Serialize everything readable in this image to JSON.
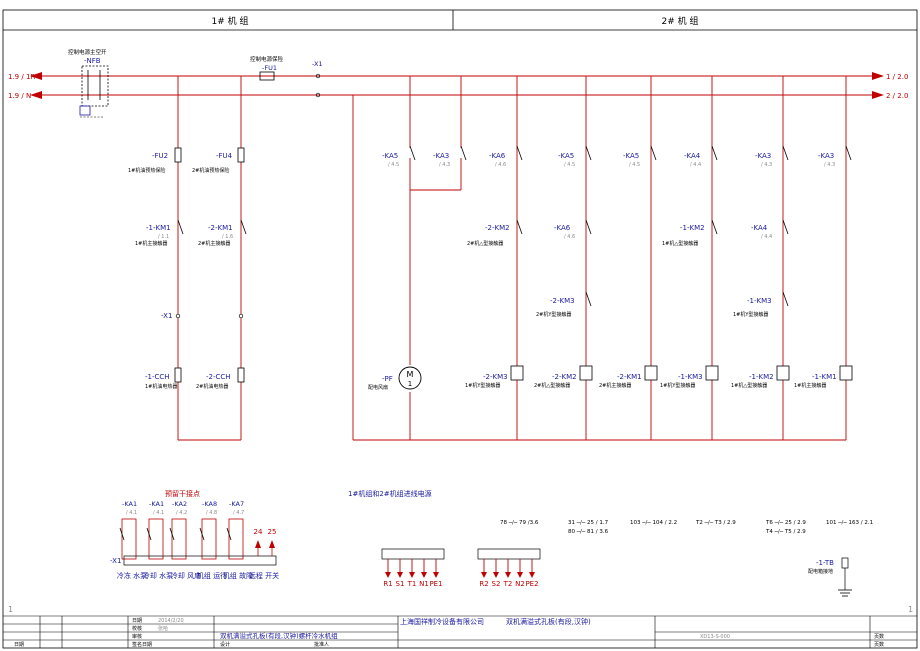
{
  "header": {
    "unit1": "1#  机  组",
    "unit2": "2#  机  组"
  },
  "power": {
    "phase_left": "1.9 / 1R",
    "neutral_left": "1.9 / N",
    "phase_right": "1 / 2.0",
    "neutral_right": "2 / 2.0",
    "breaker_caption": "控制电源主空开",
    "breaker_tag": "-NFB",
    "fuse_caption": "控制电源保险",
    "fuse_tag": "-FU1",
    "terminal_tag": "-X1"
  },
  "left_branches": [
    {
      "fuse": "-FU2",
      "fuse_note": "1#机油预热保险",
      "km": "-1-KM1",
      "km_ref": "/ 1.1",
      "km_note": "1#机主接触器",
      "x": "-X1",
      "ccr": "-1-CCH",
      "ccr_note": "1#机油电热器"
    },
    {
      "fuse": "-FU4",
      "fuse_note": "2#机油预热保险",
      "km": "-2-KM1",
      "km_ref": "/ 1.6",
      "km_note": "2#机主接触器",
      "ccr": "-2-CCH",
      "ccr_note": "2#机油电热器"
    }
  ],
  "fan": {
    "tag": "-PF",
    "caption": "配电风扇",
    "symbol": "M",
    "number": "1"
  },
  "columns": [
    {
      "top": "-KA5",
      "top_ref": "/ 4.5"
    },
    {
      "top": "-KA3",
      "top_ref": "/ 4.3"
    },
    {
      "top": "-KA6",
      "top_ref": "/ 4.6",
      "mid": "-2-KM2",
      "mid_note": "2#机△型接触器",
      "coil": "-2-KM3",
      "coil_note": "1#机Y型接触器"
    },
    {
      "top": "-KA5",
      "top_ref": "/ 4.5",
      "mid": "-KA6",
      "mid_ref": "/ 4.6",
      "low": "-2-KM3",
      "low_note": "2#机Y型接触器",
      "coil": "-2-KM2",
      "coil_note": "2#机△型接触器"
    },
    {
      "top": "-KA5",
      "top_ref": "/ 4.5",
      "coil": "-2-KM1",
      "coil_note": "2#机主接触器"
    },
    {
      "top": "-KA4",
      "top_ref": "/ 4.4",
      "mid": "-1-KM2",
      "mid_note": "1#机△型接触器",
      "coil": "-1-KM3",
      "coil_note": "1#机Y型接触器"
    },
    {
      "top": "-KA3",
      "top_ref": "/ 4.3",
      "mid": "-KA4",
      "mid_ref": "/ 4.4",
      "low": "-1-KM3",
      "low_note": "1#机Y型接触器",
      "coil": "-1-KM2",
      "coil_note": "1#机△型接触器"
    },
    {
      "top": "-KA3",
      "top_ref": "/ 4.3",
      "coil": "-1-KM1",
      "coil_note": "1#机主接触器"
    }
  ],
  "reserve": {
    "title": "预留干接点",
    "relays": [
      "-KA1",
      "-KA1",
      "-KA2",
      "-KA8",
      "-KA7"
    ],
    "refs": [
      "/ 4.1",
      "/ 4.1",
      "/ 4.2",
      "/ 4.8",
      "/ 4.7"
    ],
    "terminal": "-X1",
    "labels": [
      "冷冻 水泵",
      "冷却 水泵",
      "冷却 风扇",
      "机组 运行",
      "机组 故障",
      "远程 开关"
    ],
    "inputs": [
      "24",
      "25"
    ]
  },
  "supply": {
    "title": "1#机组和2#机组进线电源",
    "group1": [
      "R1",
      "S1",
      "T1",
      "N1",
      "PE1"
    ],
    "group2": [
      "R2",
      "S2",
      "T2",
      "N2",
      "PE2"
    ]
  },
  "earth": {
    "tag": "-1-TB",
    "caption": "配电箱接地"
  },
  "titleblock": {
    "company": "上海国祥制冷设备有限公司",
    "drawing": "双机满溢式孔板(有段,汉钟)",
    "project": "双机满溢式孔板(有段,汉钟)螺杆冷水机组",
    "code": "XD13-S-000",
    "row_design": "设计",
    "row_check": "校核",
    "row_audit": "审核",
    "row_approve": "标准化",
    "date_label": "日期",
    "date_value": "2014/2/20",
    "designer": "张哈",
    "left_label": "日期",
    "sign_label": "签名日期",
    "approve_label": "批准人",
    "sheets_label": "页数",
    "page_label": "页数"
  },
  "colors": {
    "wire": "#c00000",
    "line": "#000000",
    "text_blue": "#1a1aa0"
  }
}
